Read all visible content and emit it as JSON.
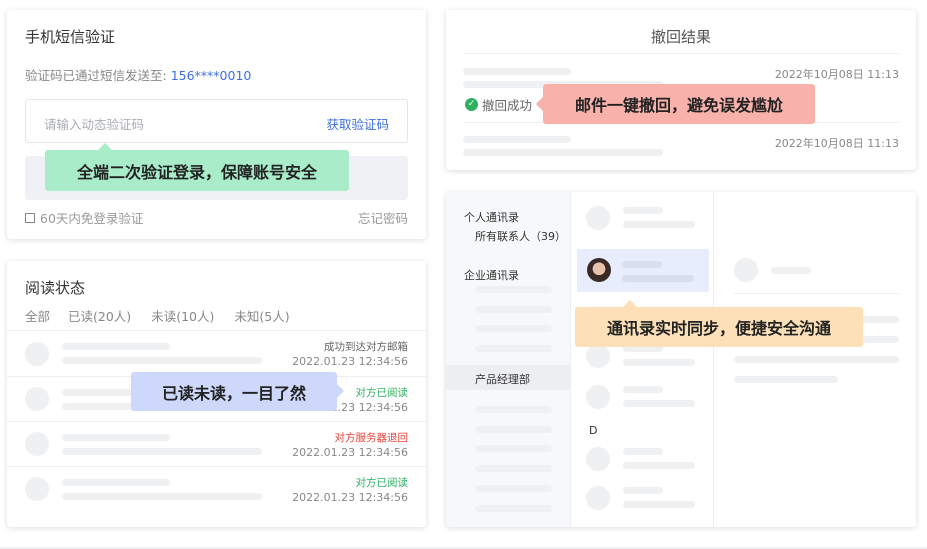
{
  "sms": {
    "title": "手机短信验证",
    "sent_prefix": "验证码已通过短信发送至:",
    "phone": "156****0010",
    "input_placeholder": "请输入动态验证码",
    "get_code": "获取验证码",
    "bubble": "全端二次验证登录，保障账号安全",
    "remember": "60天内免登录验证",
    "forgot": "忘记密码"
  },
  "recall": {
    "title": "撤回结果",
    "time1": "2022年10月08日 11:13",
    "status": "撤回成功",
    "bubble": "邮件一键撤回，避免误发尴尬",
    "time2": "2022年10月08日 11:13"
  },
  "read": {
    "title": "阅读状态",
    "filters": [
      "全部",
      "已读(20人)",
      "未读(10人)",
      "未知(5人)"
    ],
    "rows": [
      {
        "status": "成功到达对方邮箱",
        "time": "2022.01.23 12:34:56",
        "color": "#666666"
      },
      {
        "status": "对方已阅读",
        "time": "2022.01.23 12:34:56",
        "color": "#2db15f"
      },
      {
        "status": "对方服务器退回",
        "time": "2022.01.23 12:34:56",
        "color": "#e8463a"
      },
      {
        "status": "对方已阅读",
        "time": "2022.01.23 12:34:56",
        "color": "#2db15f"
      }
    ],
    "bubble": "已读未读，一目了然"
  },
  "contacts": {
    "personal": "个人通讯录",
    "all": "所有联系人（39）",
    "enterprise": "企业通讯录",
    "dept": "产品经理部",
    "letter": "D",
    "bubble": "通讯录实时同步，便捷安全沟通"
  },
  "colors": {
    "link_blue": "#3d6fe0",
    "green_bubble": "#a8ecc9",
    "red_bubble": "#f9b2ab",
    "blue_bubble": "#cdd8fb",
    "orange_bubble": "#fde0b8",
    "success_green": "#2db15f"
  }
}
